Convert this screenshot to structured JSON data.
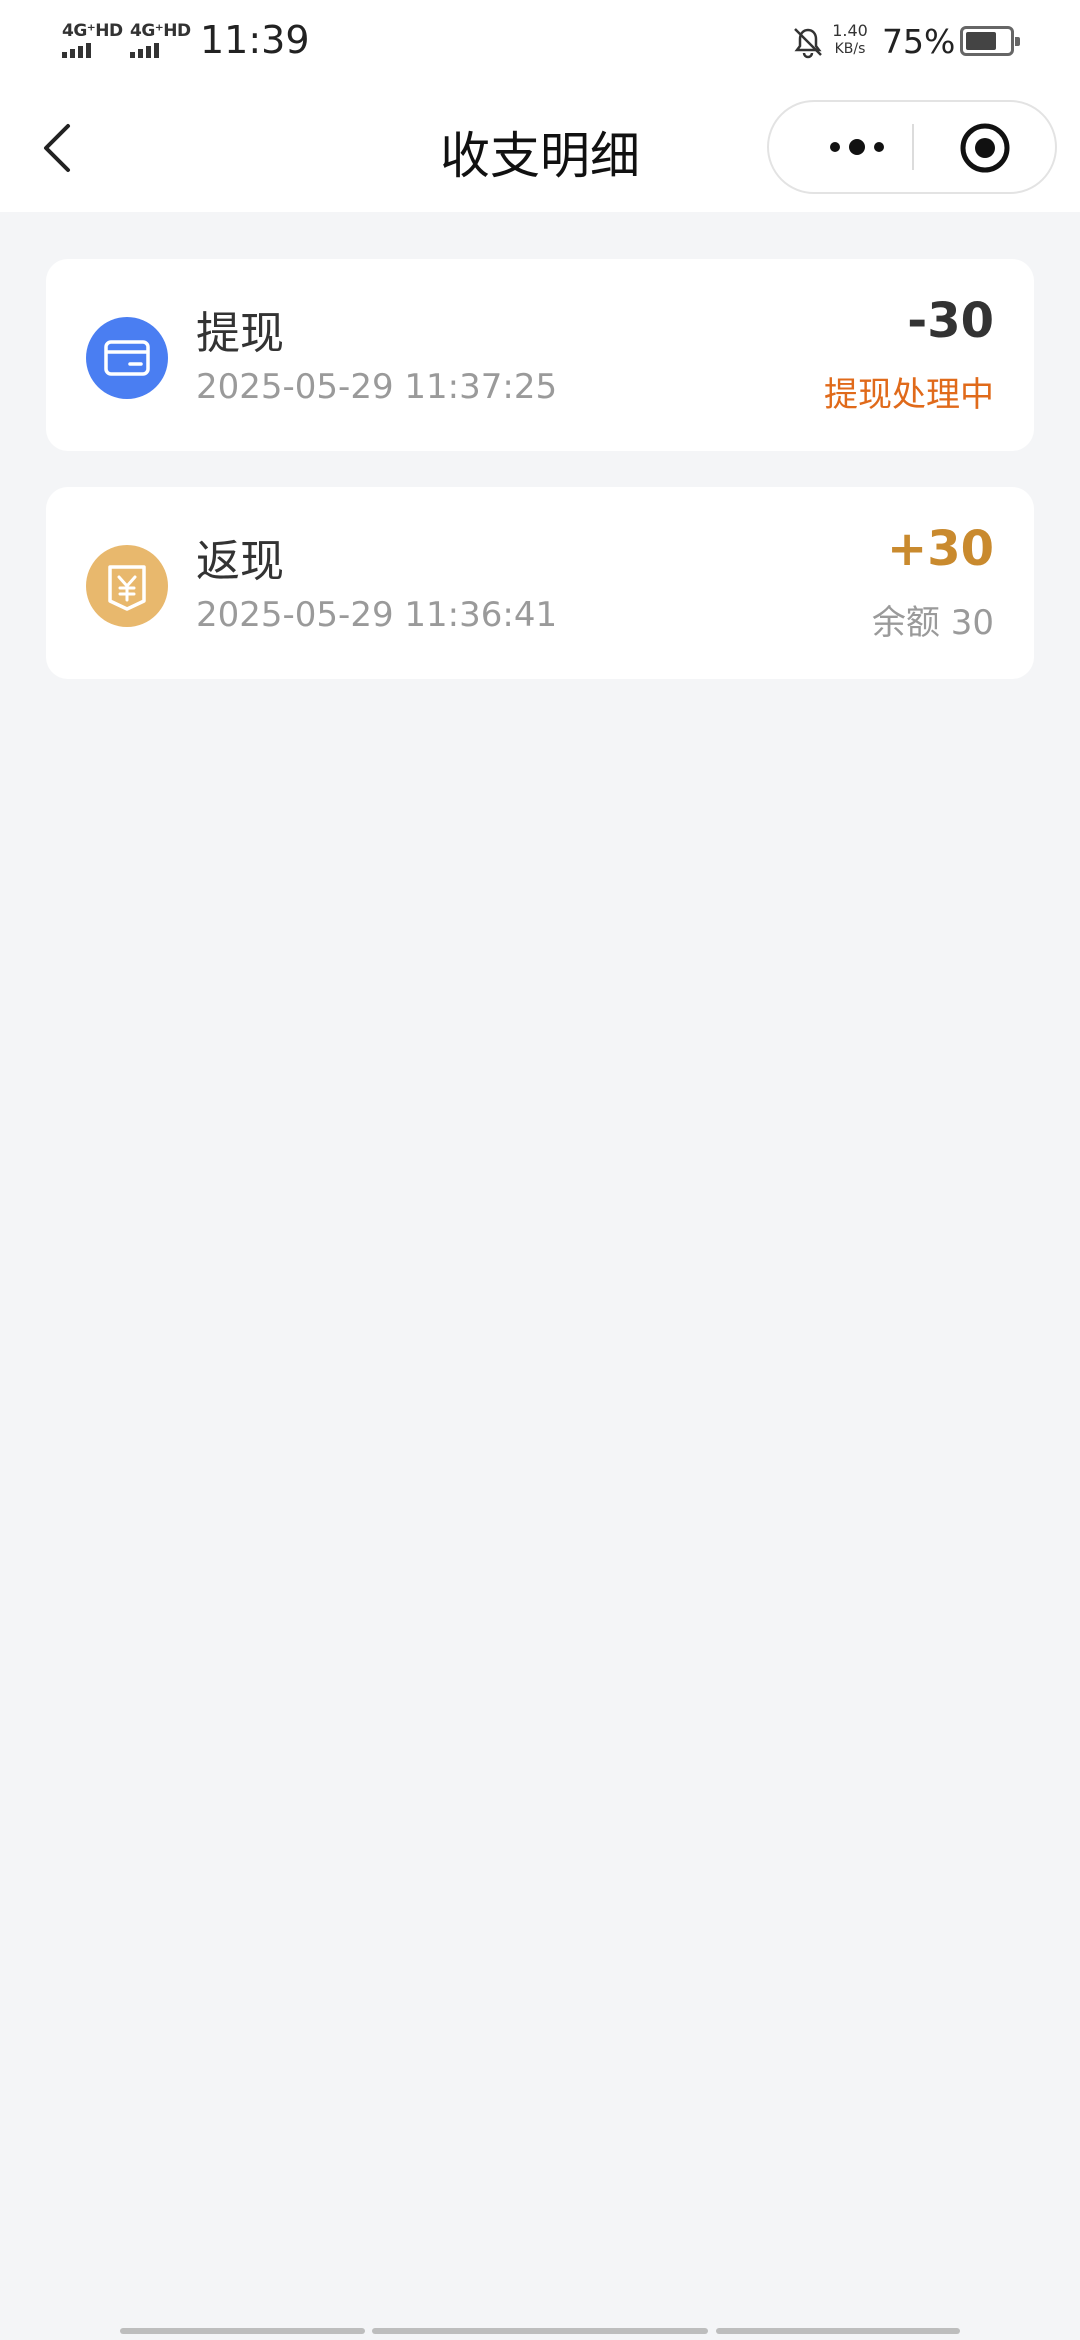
{
  "status_bar": {
    "sim1": "4G⁺HD",
    "sim2": "4G⁺HD",
    "time": "11:39",
    "speed_value": "1.40",
    "speed_unit": "KB/s",
    "battery_pct": "75%",
    "battery_level": 0.75
  },
  "header": {
    "title": "收支明细",
    "back_icon": "chevron-left-icon",
    "more_icon": "more-dots-icon",
    "close_icon": "target-circle-icon"
  },
  "records": [
    {
      "title": "提现",
      "time": "2025-05-29 11:37:25",
      "amount": "-30",
      "sub": "提现处理中",
      "icon": "card-icon",
      "icon_bg": "#4a7ef2",
      "amount_color": "#333333",
      "sub_color": "#e06a1a"
    },
    {
      "title": "返现",
      "time": "2025-05-29 11:36:41",
      "amount": "+30",
      "sub": "余额 30",
      "icon": "yuan-icon",
      "icon_bg": "#e8b86d",
      "amount_color": "#c98a2e",
      "sub_color": "#9a9a9a"
    }
  ]
}
